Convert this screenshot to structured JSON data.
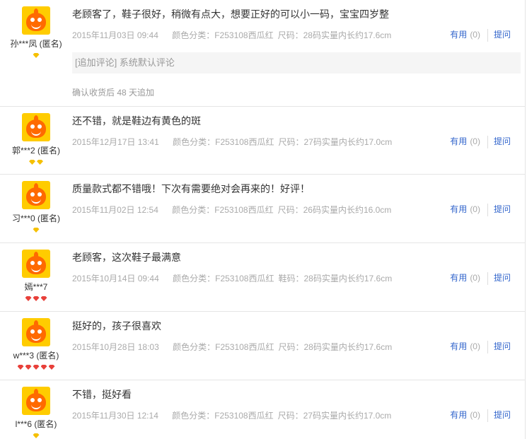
{
  "reviews": [
    {
      "user": "孙***凤 (匿名)",
      "gems": [
        "yellow"
      ],
      "text": "老顾客了，鞋子很好，稍微有点大，想要正好的可以小一码，宝宝四岁整",
      "date": "2015年11月03日 09:44",
      "color": "颜色分类：F253108西瓜红",
      "size": "尺码：28码实量内长约17.6cm",
      "useful_label": "有用",
      "useful_count": "(0)",
      "ask_label": "提问",
      "append_text": "[追加评论] 系统默认评论",
      "append_note": "确认收货后 48 天追加"
    },
    {
      "user": "郭***2 (匿名)",
      "gems": [
        "yellow",
        "yellow"
      ],
      "text": "还不错，就是鞋边有黄色的斑",
      "date": "2015年12月17日 13:41",
      "color": "颜色分类：F253108西瓜红",
      "size": "尺码：27码实量内长约17.0cm",
      "useful_label": "有用",
      "useful_count": "(0)",
      "ask_label": "提问"
    },
    {
      "user": "习***0 (匿名)",
      "gems": [
        "yellow"
      ],
      "text": "质量款式都不错哦！下次有需要绝对会再来的！好评！",
      "date": "2015年11月02日 12:54",
      "color": "颜色分类：F253108西瓜红",
      "size": "尺码：26码实量内长约16.0cm",
      "useful_label": "有用",
      "useful_count": "(0)",
      "ask_label": "提问"
    },
    {
      "user": "嫣***7",
      "gems": [
        "red",
        "red",
        "red"
      ],
      "text": "老顾客，这次鞋子最满意",
      "date": "2015年10月14日 09:44",
      "color": "颜色分类：F253108西瓜红",
      "size": "鞋码：28码实量内长约17.6cm",
      "useful_label": "有用",
      "useful_count": "(0)",
      "ask_label": "提问"
    },
    {
      "user": "w***3 (匿名)",
      "gems": [
        "red",
        "red",
        "red",
        "red",
        "red"
      ],
      "text": "挺好的，孩子很喜欢",
      "date": "2015年10月28日 18:03",
      "color": "颜色分类：F253108西瓜红",
      "size": "尺码：28码实量内长约17.6cm",
      "useful_label": "有用",
      "useful_count": "(0)",
      "ask_label": "提问"
    },
    {
      "user": "l***6 (匿名)",
      "gems": [
        "yellow"
      ],
      "text": "不错，挺好看",
      "date": "2015年11月30日 12:14",
      "color": "颜色分类：F253108西瓜红",
      "size": "尺码：27码实量内长约17.0cm",
      "useful_label": "有用",
      "useful_count": "(0)",
      "ask_label": "提问"
    }
  ]
}
